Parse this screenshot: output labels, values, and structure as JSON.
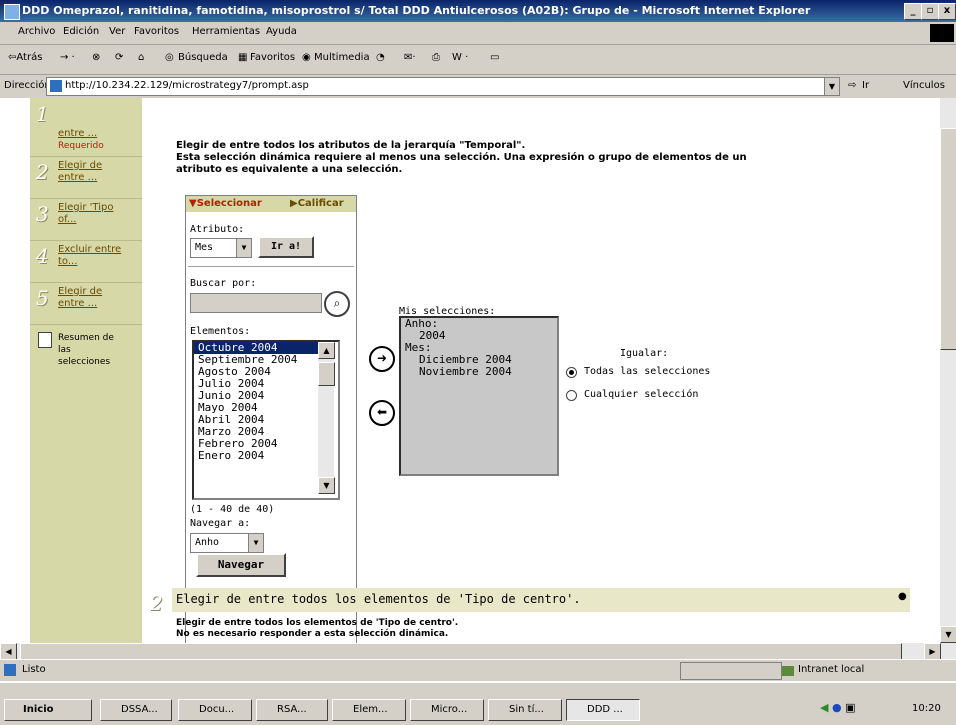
{
  "window": {
    "title": "DDD Omeprazol, ranitidina, famotidina, misoprostrol s/ Total DDD Antiulcerosos (A02B): Grupo de - Microsoft Internet Explorer",
    "min": "_",
    "max": "▫",
    "close": "x"
  },
  "menu": [
    "Archivo",
    "Edición",
    "Ver",
    "Favoritos",
    "Herramientas",
    "Ayuda"
  ],
  "toolbar": {
    "back": "⇦Atrás",
    "search": "Búsqueda",
    "favorites": "Favoritos",
    "multimedia": "Multimedia"
  },
  "address": {
    "label": "Dirección",
    "url": "http://10.234.22.129/microstrategy7/prompt.asp",
    "go": "Ir",
    "links": "Vínculos"
  },
  "nav": [
    {
      "num": "1",
      "label": "entre ...",
      "sub": "Requerido"
    },
    {
      "num": "2",
      "label": "Elegir de entre ..."
    },
    {
      "num": "3",
      "label": "Elegir 'Tipo of..."
    },
    {
      "num": "4",
      "label": "Excluir entre to..."
    },
    {
      "num": "5",
      "label": "Elegir de entre ..."
    },
    {
      "num": "",
      "label": "Resumen de las selecciones"
    }
  ],
  "prompt1": {
    "line1": "Elegir de entre todos los atributos de la jerarquía \"Temporal\".",
    "line2": "Esta selección dinámica requiere al menos una selección. Una expresión o grupo de elementos de un",
    "line3": "atributo es equivalente a una selección."
  },
  "panel": {
    "tab_select": "Seleccionar",
    "tab_qualify": "Calificar",
    "attr_label": "Atributo:",
    "attr_value": "Mes",
    "go_button": "Ir a!",
    "search_label": "Buscar por:",
    "elements_label": "Elementos:",
    "elements": [
      "Octubre 2004",
      "Septiembre 2004",
      "Agosto 2004",
      "Julio 2004",
      "Junio 2004",
      "Mayo 2004",
      "Abril 2004",
      "Marzo 2004",
      "Febrero 2004",
      "Enero 2004"
    ],
    "count": "(1 - 40 de 40)",
    "navigate_label": "Navegar a:",
    "navigate_value": "Anho",
    "navigate_button": "Navegar"
  },
  "selections": {
    "label": "Mis selecciones:",
    "items": [
      "Anho:",
      "2004",
      "Mes:",
      "Diciembre 2004",
      "Noviembre 2004"
    ]
  },
  "match": {
    "label": "Igualar:",
    "opt_all": "Todas las selecciones",
    "opt_any": "Cualquier selección"
  },
  "prompt2": {
    "header": "Elegir de entre todos los elementos de 'Tipo de centro'.",
    "line1": "Elegir de entre todos los elementos de 'Tipo de centro'.",
    "line2": "No es necesario responder a esta selección dinámica."
  },
  "status": {
    "text": "Listo",
    "zone": "Intranet local"
  },
  "taskbar": {
    "start": "Inicio",
    "tasks": [
      "DSSA...",
      "Docu...",
      "RSA...",
      "Elem...",
      "Micro...",
      "Sin tí...",
      "DDD ..."
    ],
    "clock": "10:20"
  }
}
